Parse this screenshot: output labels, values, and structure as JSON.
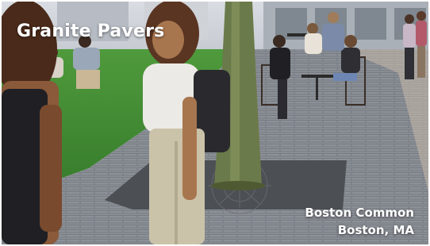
{
  "caption": {
    "title": "Granite Pavers",
    "location_name": "Boston Common",
    "location_city": "Boston, MA"
  },
  "colors": {
    "text": "#ffffff",
    "grass": "#3f8a34",
    "pavers": "#8b8f96",
    "tree_grate": "#4a4e52"
  }
}
